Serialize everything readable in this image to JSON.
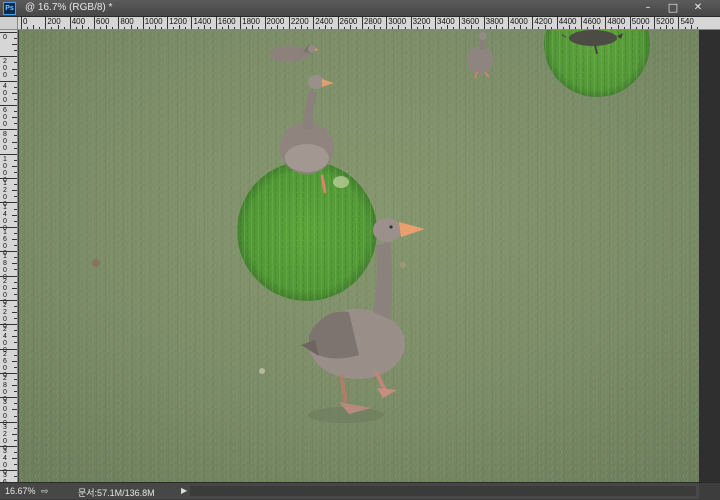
{
  "window": {
    "app_icon": "Ps",
    "title": "@ 16.7% (RGB/8) *",
    "buttons": {
      "minimize": "–",
      "maximize": "□",
      "close": "✕"
    }
  },
  "ruler": {
    "horizontal_labels": [
      "0",
      "200",
      "400",
      "600",
      "800",
      "1000",
      "1200",
      "1400",
      "1600",
      "1800",
      "2000",
      "2200",
      "2400",
      "2600",
      "2800",
      "3000",
      "3200",
      "3400",
      "3600",
      "3800",
      "4000",
      "4200",
      "4400",
      "4600",
      "4800",
      "5000",
      "5200",
      "540"
    ],
    "vertical_labels": [
      "0",
      "200",
      "400",
      "600",
      "800",
      "1000",
      "1200",
      "1400",
      "1600",
      "1800",
      "2000",
      "2200",
      "2400",
      "2600",
      "2800",
      "3000",
      "3200",
      "3400",
      "3600"
    ]
  },
  "canvas": {
    "photo_description_icon": "geese-on-grass-photo",
    "colors": {
      "grass": "#7c8e69",
      "highlight": "#4f9a33"
    }
  },
  "status": {
    "zoom": "16.67%",
    "doc_info": "문서:57.1M/136.8M",
    "share_icon": "share-icon",
    "menu_arrow_icon": "triangle-right-icon"
  }
}
